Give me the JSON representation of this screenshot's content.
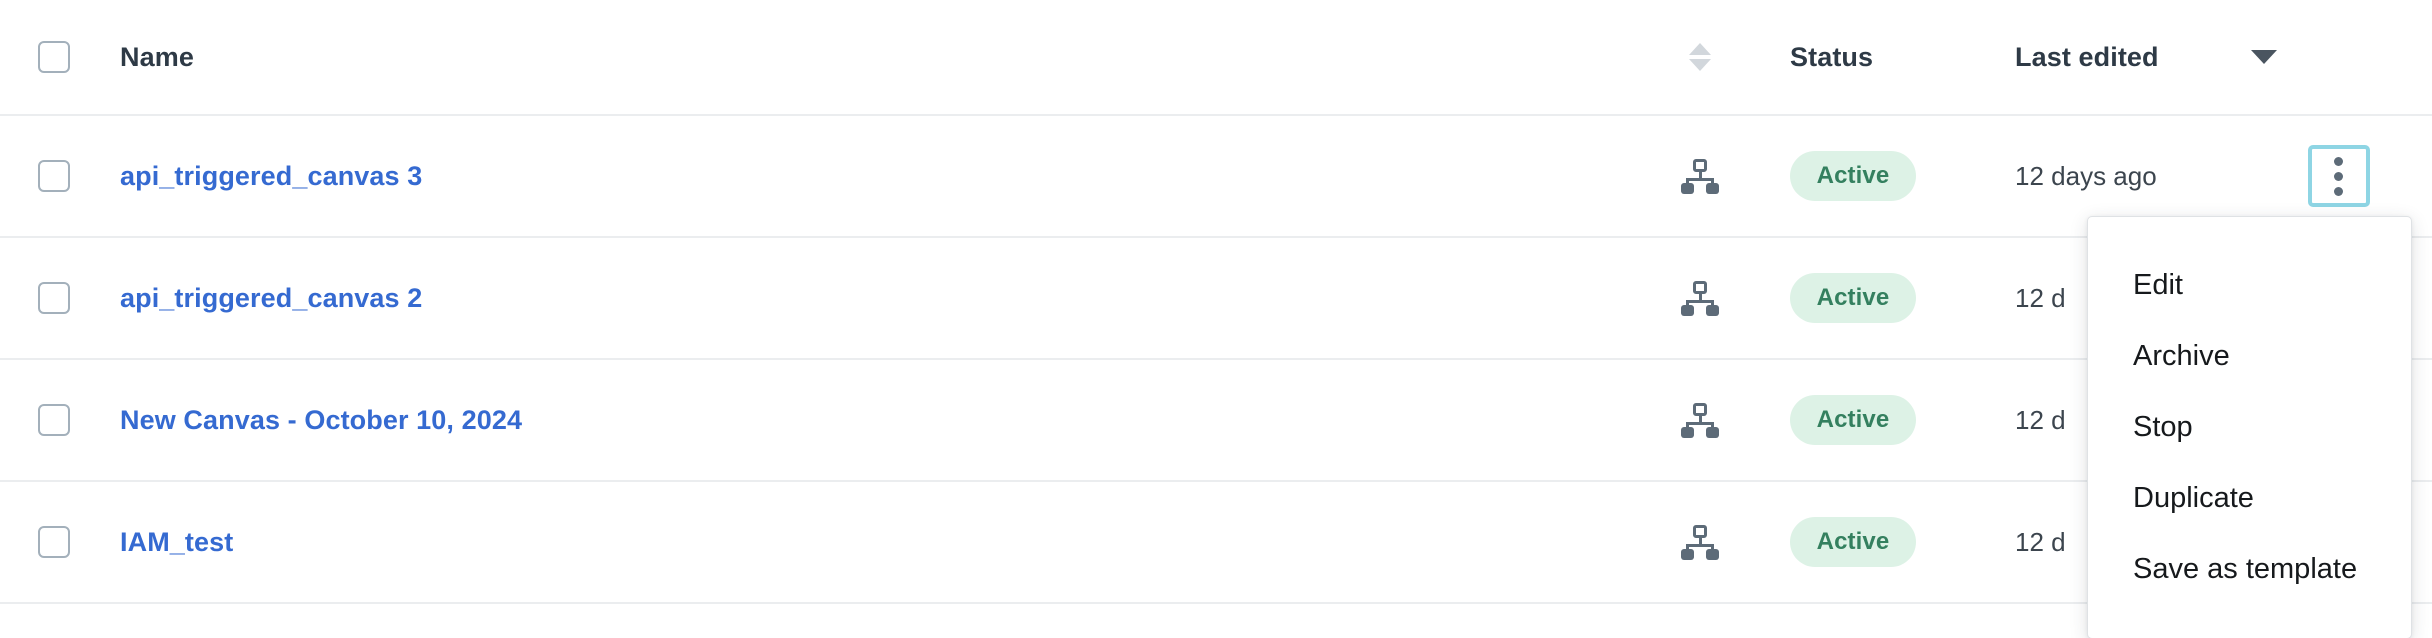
{
  "table": {
    "columns": {
      "name": "Name",
      "sort_icon": "sort-updown-icon",
      "status": "Status",
      "last_edited": "Last edited",
      "last_edited_sort_icon": "triangle-down-icon"
    },
    "select_all_checkbox": "select-all-checkbox",
    "rows": [
      {
        "name": "api_triggered_canvas 3",
        "type_icon": "hierarchy-icon",
        "status": "Active",
        "last_edited": "12 days ago",
        "menu_icon": "kebab-menu-icon"
      },
      {
        "name": "api_triggered_canvas 2",
        "type_icon": "hierarchy-icon",
        "status": "Active",
        "last_edited": "12 d",
        "menu_icon": "kebab-menu-icon"
      },
      {
        "name": "New Canvas - October 10, 2024",
        "type_icon": "hierarchy-icon",
        "status": "Active",
        "last_edited": "12 d",
        "menu_icon": "kebab-menu-icon"
      },
      {
        "name": "IAM_test",
        "type_icon": "hierarchy-icon",
        "status": "Active",
        "last_edited": "12 d",
        "menu_icon": "kebab-menu-icon"
      }
    ]
  },
  "dropdown": {
    "open_for_row": 0,
    "items": [
      {
        "label": "Edit"
      },
      {
        "label": "Archive"
      },
      {
        "label": "Stop"
      },
      {
        "label": "Duplicate"
      },
      {
        "label": "Save as template"
      }
    ]
  },
  "colors": {
    "link": "#356ad1",
    "badge_bg": "#ddf2e6",
    "badge_text": "#34805f",
    "header_text": "#2e3a46",
    "row_border": "#ebedef",
    "focus_ring": "#8ed5e4",
    "icon_gray": "#5d6b78",
    "checkbox_border": "#a3b0bb"
  }
}
